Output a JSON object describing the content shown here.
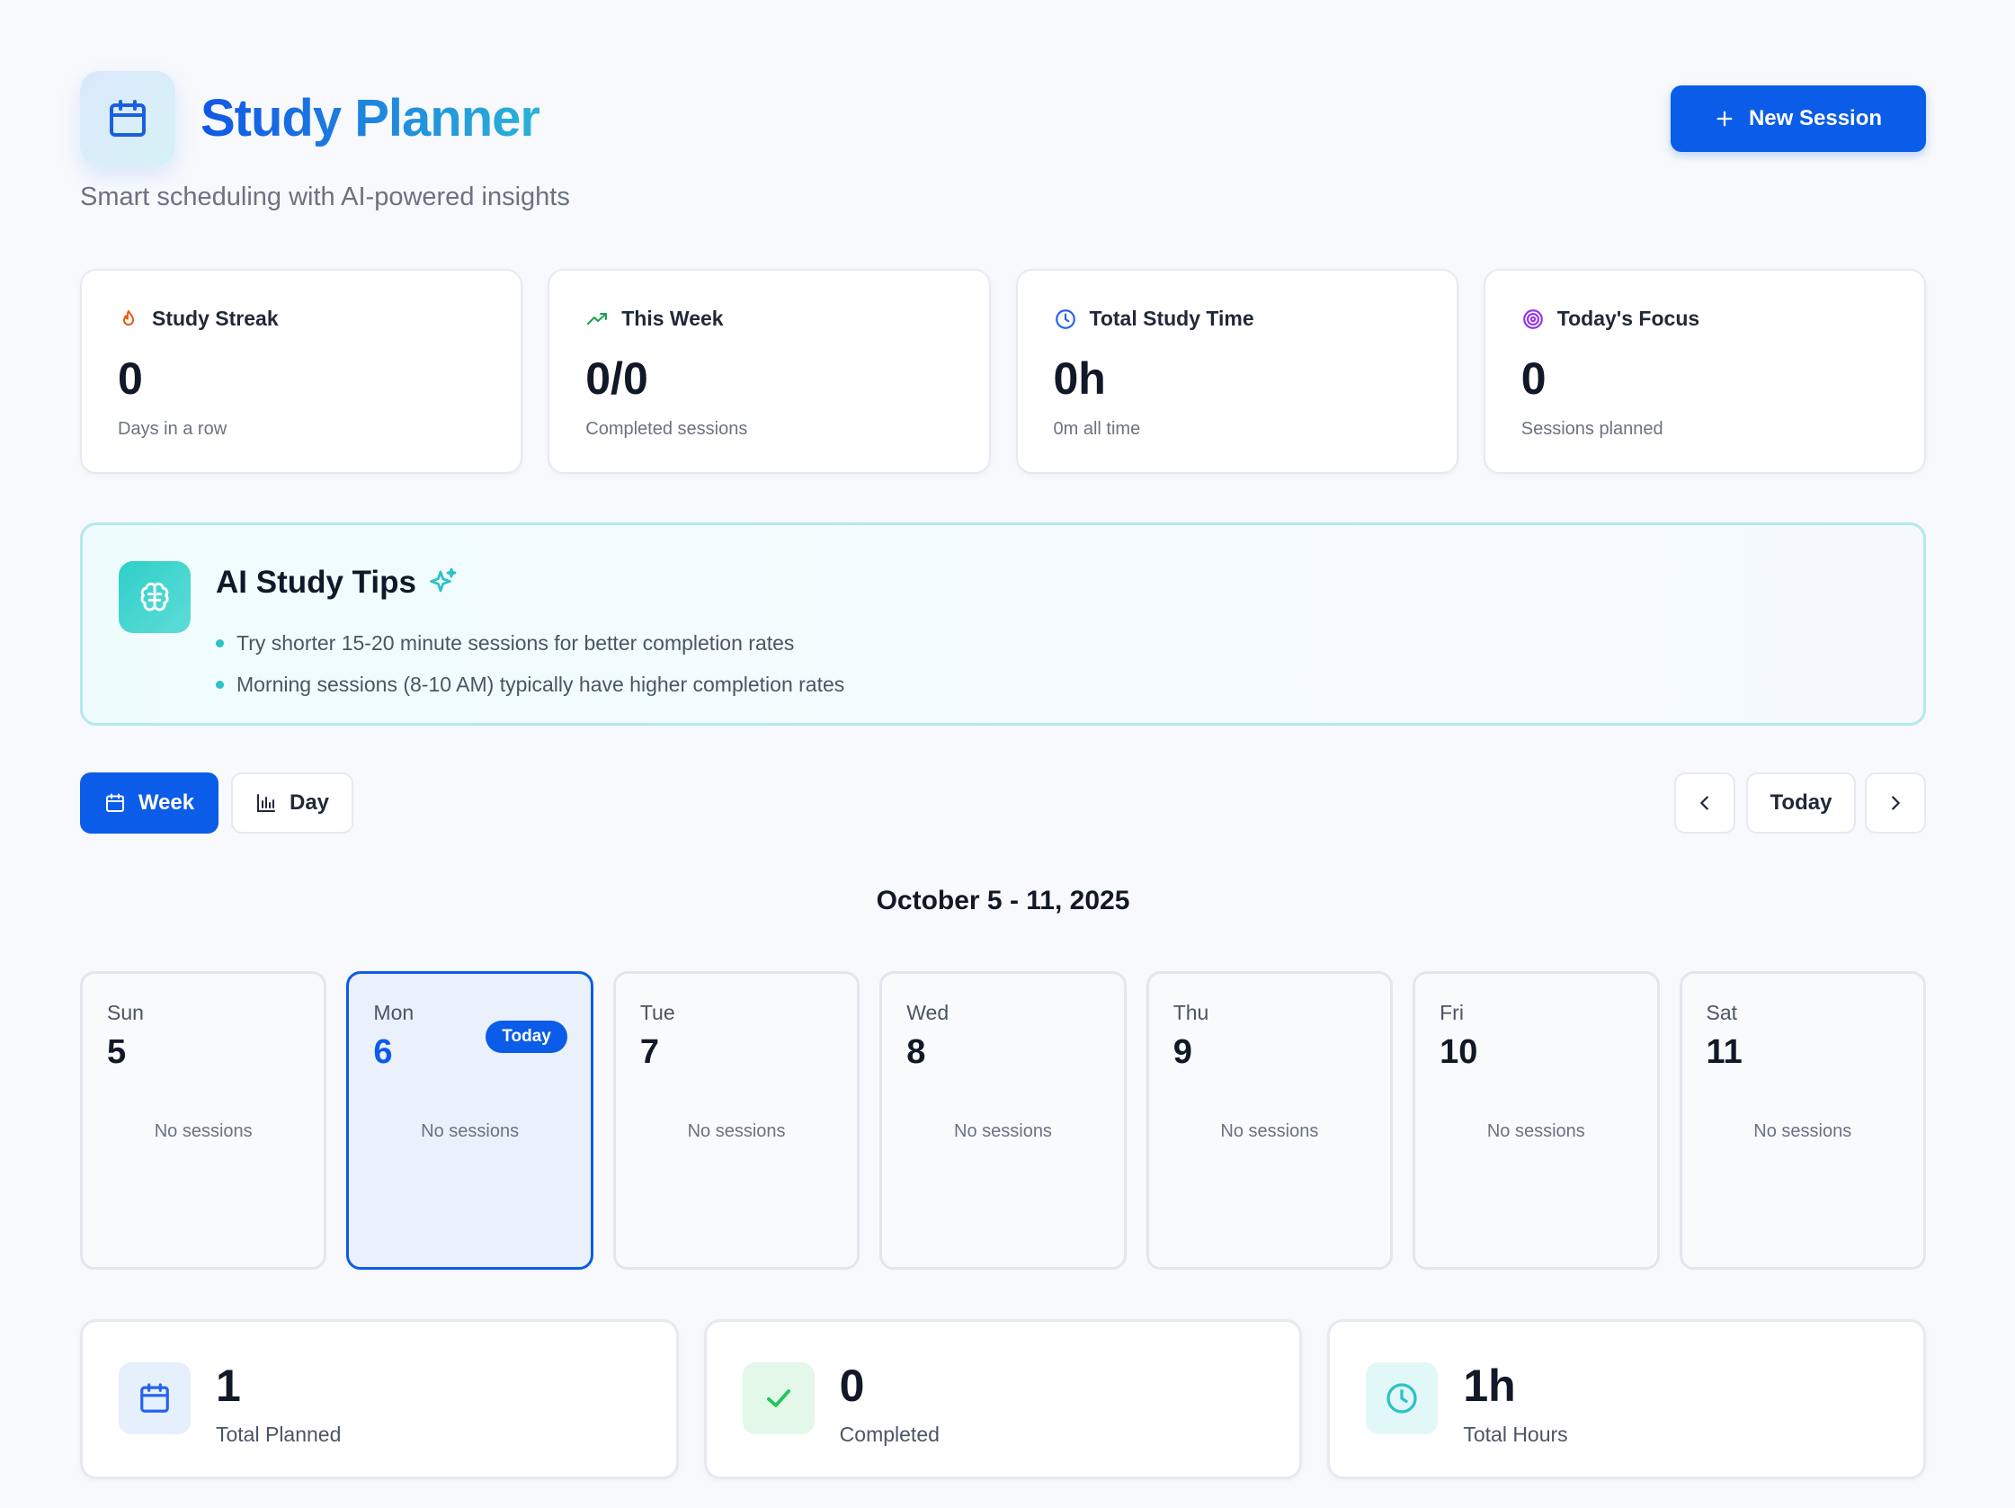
{
  "header": {
    "title": "Study Planner",
    "subtitle": "Smart scheduling with AI-powered insights",
    "new_session_label": "New Session"
  },
  "stats": [
    {
      "label": "Study Streak",
      "value": "0",
      "sub": "Days in a row",
      "icon": "flame-icon",
      "color": "#ea580c"
    },
    {
      "label": "This Week",
      "value": "0/0",
      "sub": "Completed sessions",
      "icon": "trending-up-icon",
      "color": "#16a34a"
    },
    {
      "label": "Total Study Time",
      "value": "0h",
      "sub": "0m all time",
      "icon": "clock-icon",
      "color": "#2563eb"
    },
    {
      "label": "Today's Focus",
      "value": "0",
      "sub": "Sessions planned",
      "icon": "target-icon",
      "color": "#9333ea"
    }
  ],
  "tips": {
    "title": "AI Study Tips",
    "items": [
      "Try shorter 15-20 minute sessions for better completion rates",
      "Morning sessions (8-10 AM) typically have higher completion rates"
    ]
  },
  "controls": {
    "week_label": "Week",
    "day_label": "Day",
    "today_label": "Today"
  },
  "range_title": "October 5 - 11, 2025",
  "week": {
    "today_badge": "Today",
    "days": [
      {
        "name": "Sun",
        "num": "5",
        "status": "No sessions"
      },
      {
        "name": "Mon",
        "num": "6",
        "status": "No sessions"
      },
      {
        "name": "Tue",
        "num": "7",
        "status": "No sessions"
      },
      {
        "name": "Wed",
        "num": "8",
        "status": "No sessions"
      },
      {
        "name": "Thu",
        "num": "9",
        "status": "No sessions"
      },
      {
        "name": "Fri",
        "num": "10",
        "status": "No sessions"
      },
      {
        "name": "Sat",
        "num": "11",
        "status": "No sessions"
      }
    ]
  },
  "summary": [
    {
      "value": "1",
      "label": "Total Planned",
      "icon": "calendar-icon",
      "color": "#2563eb"
    },
    {
      "value": "0",
      "label": "Completed",
      "icon": "check-icon",
      "color": "#22c55e"
    },
    {
      "value": "1h",
      "label": "Total Hours",
      "icon": "clock-icon",
      "color": "#2dc2c7"
    }
  ],
  "colors": {
    "primary": "#0b5ce8",
    "accent_teal": "#2dc2c7",
    "background": "#f7f9fc"
  }
}
